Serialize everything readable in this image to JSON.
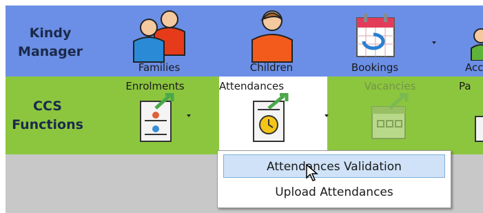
{
  "ribbon": {
    "kindy_manager": {
      "line1": "Kindy",
      "line2": "Manager"
    },
    "families_label": "Families",
    "children_label": "Children",
    "bookings_label": "Bookings",
    "partial_label": "Acc",
    "ccs_functions": {
      "line1": "CCS",
      "line2": "Functions"
    },
    "enrolments_label": "Enrolments",
    "attendances_label": "Attendances",
    "vacancies_label": "Vacancies",
    "partial_label_2": "Pa"
  },
  "menu": {
    "items": [
      {
        "label": "Attendances Validation"
      },
      {
        "label": "Upload Attendances"
      }
    ]
  },
  "icons": {
    "families": "family-icon",
    "children": "child-icon",
    "bookings": "calendar-icon",
    "enrolments": "enrolment-form-icon",
    "attendances": "attendance-form-clock-icon",
    "vacancies": "vacancy-calendar-icon",
    "cursor": "mouse-pointer-icon"
  },
  "colors": {
    "top_row": "#6b8fe6",
    "second_row": "#8cc63f",
    "highlight": "#cfe2f7"
  }
}
